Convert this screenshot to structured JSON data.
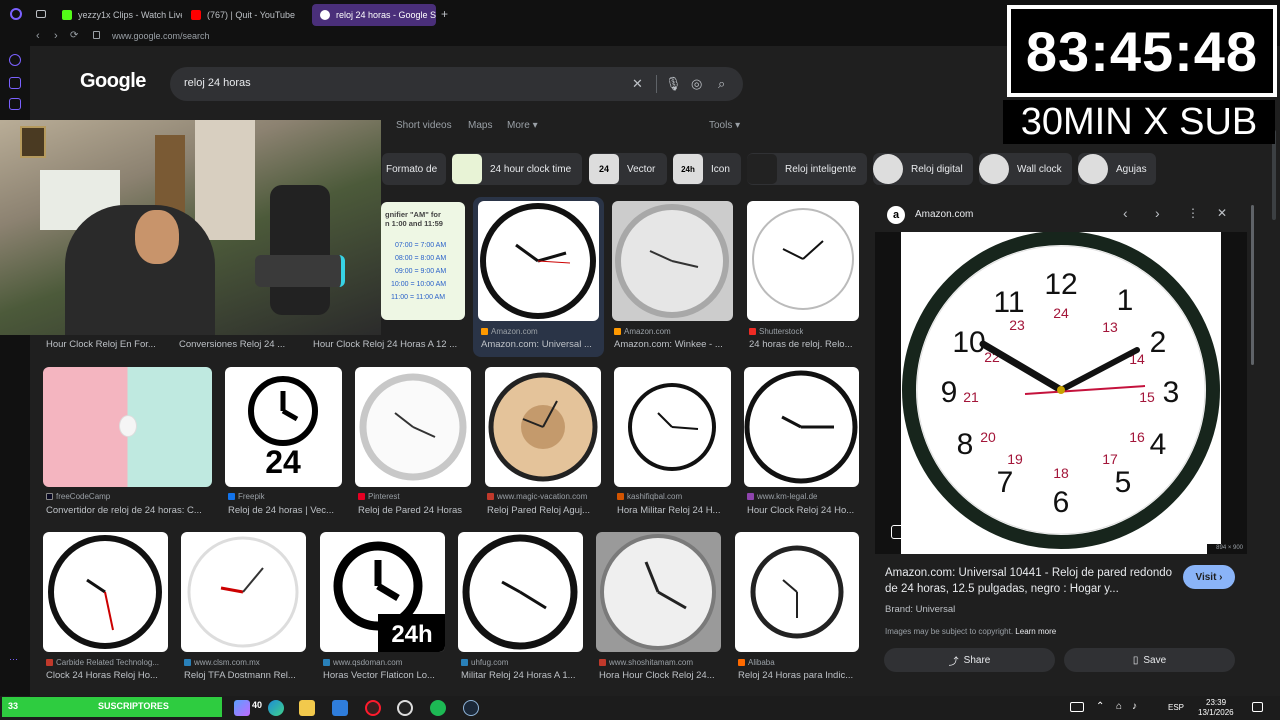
{
  "browser": {
    "tabs": [
      {
        "label": "yezzy1x Clips - Watch Live",
        "color": "#53fc18"
      },
      {
        "label": "(767) | Quit - YouTube",
        "color": "#ff0000"
      },
      {
        "label": "reloj 24 horas - Google Se",
        "color": "#ffffff"
      }
    ],
    "url": "www.google.com/search"
  },
  "google": {
    "logo": "Google",
    "query": "reloj 24 horas",
    "tabs": [
      "Short videos",
      "Maps",
      "More",
      "Tools"
    ]
  },
  "chips": [
    {
      "label": "Formato de",
      "thumb": ""
    },
    {
      "label": "24 hour clock time",
      "thumb": ""
    },
    {
      "label": "Vector",
      "thumb": "24"
    },
    {
      "label": "Icon",
      "thumb": "24h"
    },
    {
      "label": "Reloj inteligente",
      "thumb": ""
    },
    {
      "label": "Reloj digital",
      "thumb": ""
    },
    {
      "label": "Wall clock",
      "thumb": ""
    },
    {
      "label": "Agujas",
      "thumb": ""
    }
  ],
  "row1_titles": [
    "Hour Clock Reloj En For...",
    "Conversiones Reloj 24 ...",
    "Hour Clock Reloj 24 Horas A 12 ..."
  ],
  "chart_snippet": {
    "heading1": "gnifier \"AM\" for",
    "heading2": "n 1:00 and 11:59",
    "rows": [
      "07:00 = 7:00 AM",
      "08:00 = 8:00 AM",
      "09:00 = 9:00 AM",
      "10:00 = 10:00 AM",
      "11:00 = 11:00 AM"
    ]
  },
  "results_row1": [
    {
      "source": "Amazon.com",
      "title": "Amazon.com: Universal ...",
      "color": "#ff9900"
    },
    {
      "source": "Amazon.com",
      "title": "Amazon.com: Winkee - ...",
      "color": "#ff9900"
    },
    {
      "source": "Shutterstock",
      "title": "24 horas de reloj. Relo...",
      "color": "#ee2b24"
    }
  ],
  "results_row2": [
    {
      "source": "freeCodeCamp",
      "title": "Convertidor de reloj de 24 horas: C...",
      "color": "#0a0a23"
    },
    {
      "source": "Freepik",
      "title": "Reloj de 24 horas | Vec...",
      "color": "#1273eb"
    },
    {
      "source": "Pinterest",
      "title": "Reloj de Pared 24 Horas",
      "color": "#e60023"
    },
    {
      "source": "www.magic-vacation.com",
      "title": "Reloj Pared Reloj Aguj...",
      "color": "#c0392b"
    },
    {
      "source": "kashifiqbal.com",
      "title": "Hora Militar Reloj 24 H...",
      "color": "#d35400"
    },
    {
      "source": "www.km-legal.de",
      "title": "Hour Clock Reloj 24 Ho...",
      "color": "#8e44ad"
    }
  ],
  "results_row3": [
    {
      "source": "Carbide Related Technolog...",
      "title": "Clock 24 Horas Reloj Ho...",
      "color": "#c0392b"
    },
    {
      "source": "www.clsm.com.mx",
      "title": "Reloj TFA Dostmann Rel...",
      "color": "#2980b9"
    },
    {
      "source": "www.qsdoman.com",
      "title": "Horas Vector Flaticon Lo...",
      "color": "#2980b9"
    },
    {
      "source": "uhfug.com",
      "title": "Militar Reloj 24 Horas A 1...",
      "color": "#2980b9"
    },
    {
      "source": "www.shoshitamam.com",
      "title": "Hora Hour Clock Reloj 24...",
      "color": "#c0392b"
    },
    {
      "source": "Alibaba",
      "title": "Reloj 24 Horas para Indic...",
      "color": "#ff6a00"
    }
  ],
  "panel": {
    "source": "Amazon.com",
    "size_label": "894 × 900",
    "title": "Amazon.com: Universal 10441 - Reloj de pared redondo de 24 horas, 12.5 pulgadas, negro : Hogar y...",
    "brand": "Brand: Universal",
    "copyright": "Images may be subject to copyright.",
    "learn_more": "Learn more",
    "visit": "Visit",
    "share": "Share",
    "save": "Save"
  },
  "overlay": {
    "timer": "83:45:48",
    "promo": "30MIN X SUB",
    "sub_count": "33",
    "sub_label": "SUSCRIPTORES"
  },
  "taskbar": {
    "badge": "40",
    "lang": "ESP",
    "time": "23:39",
    "date": "13/1/2026"
  }
}
